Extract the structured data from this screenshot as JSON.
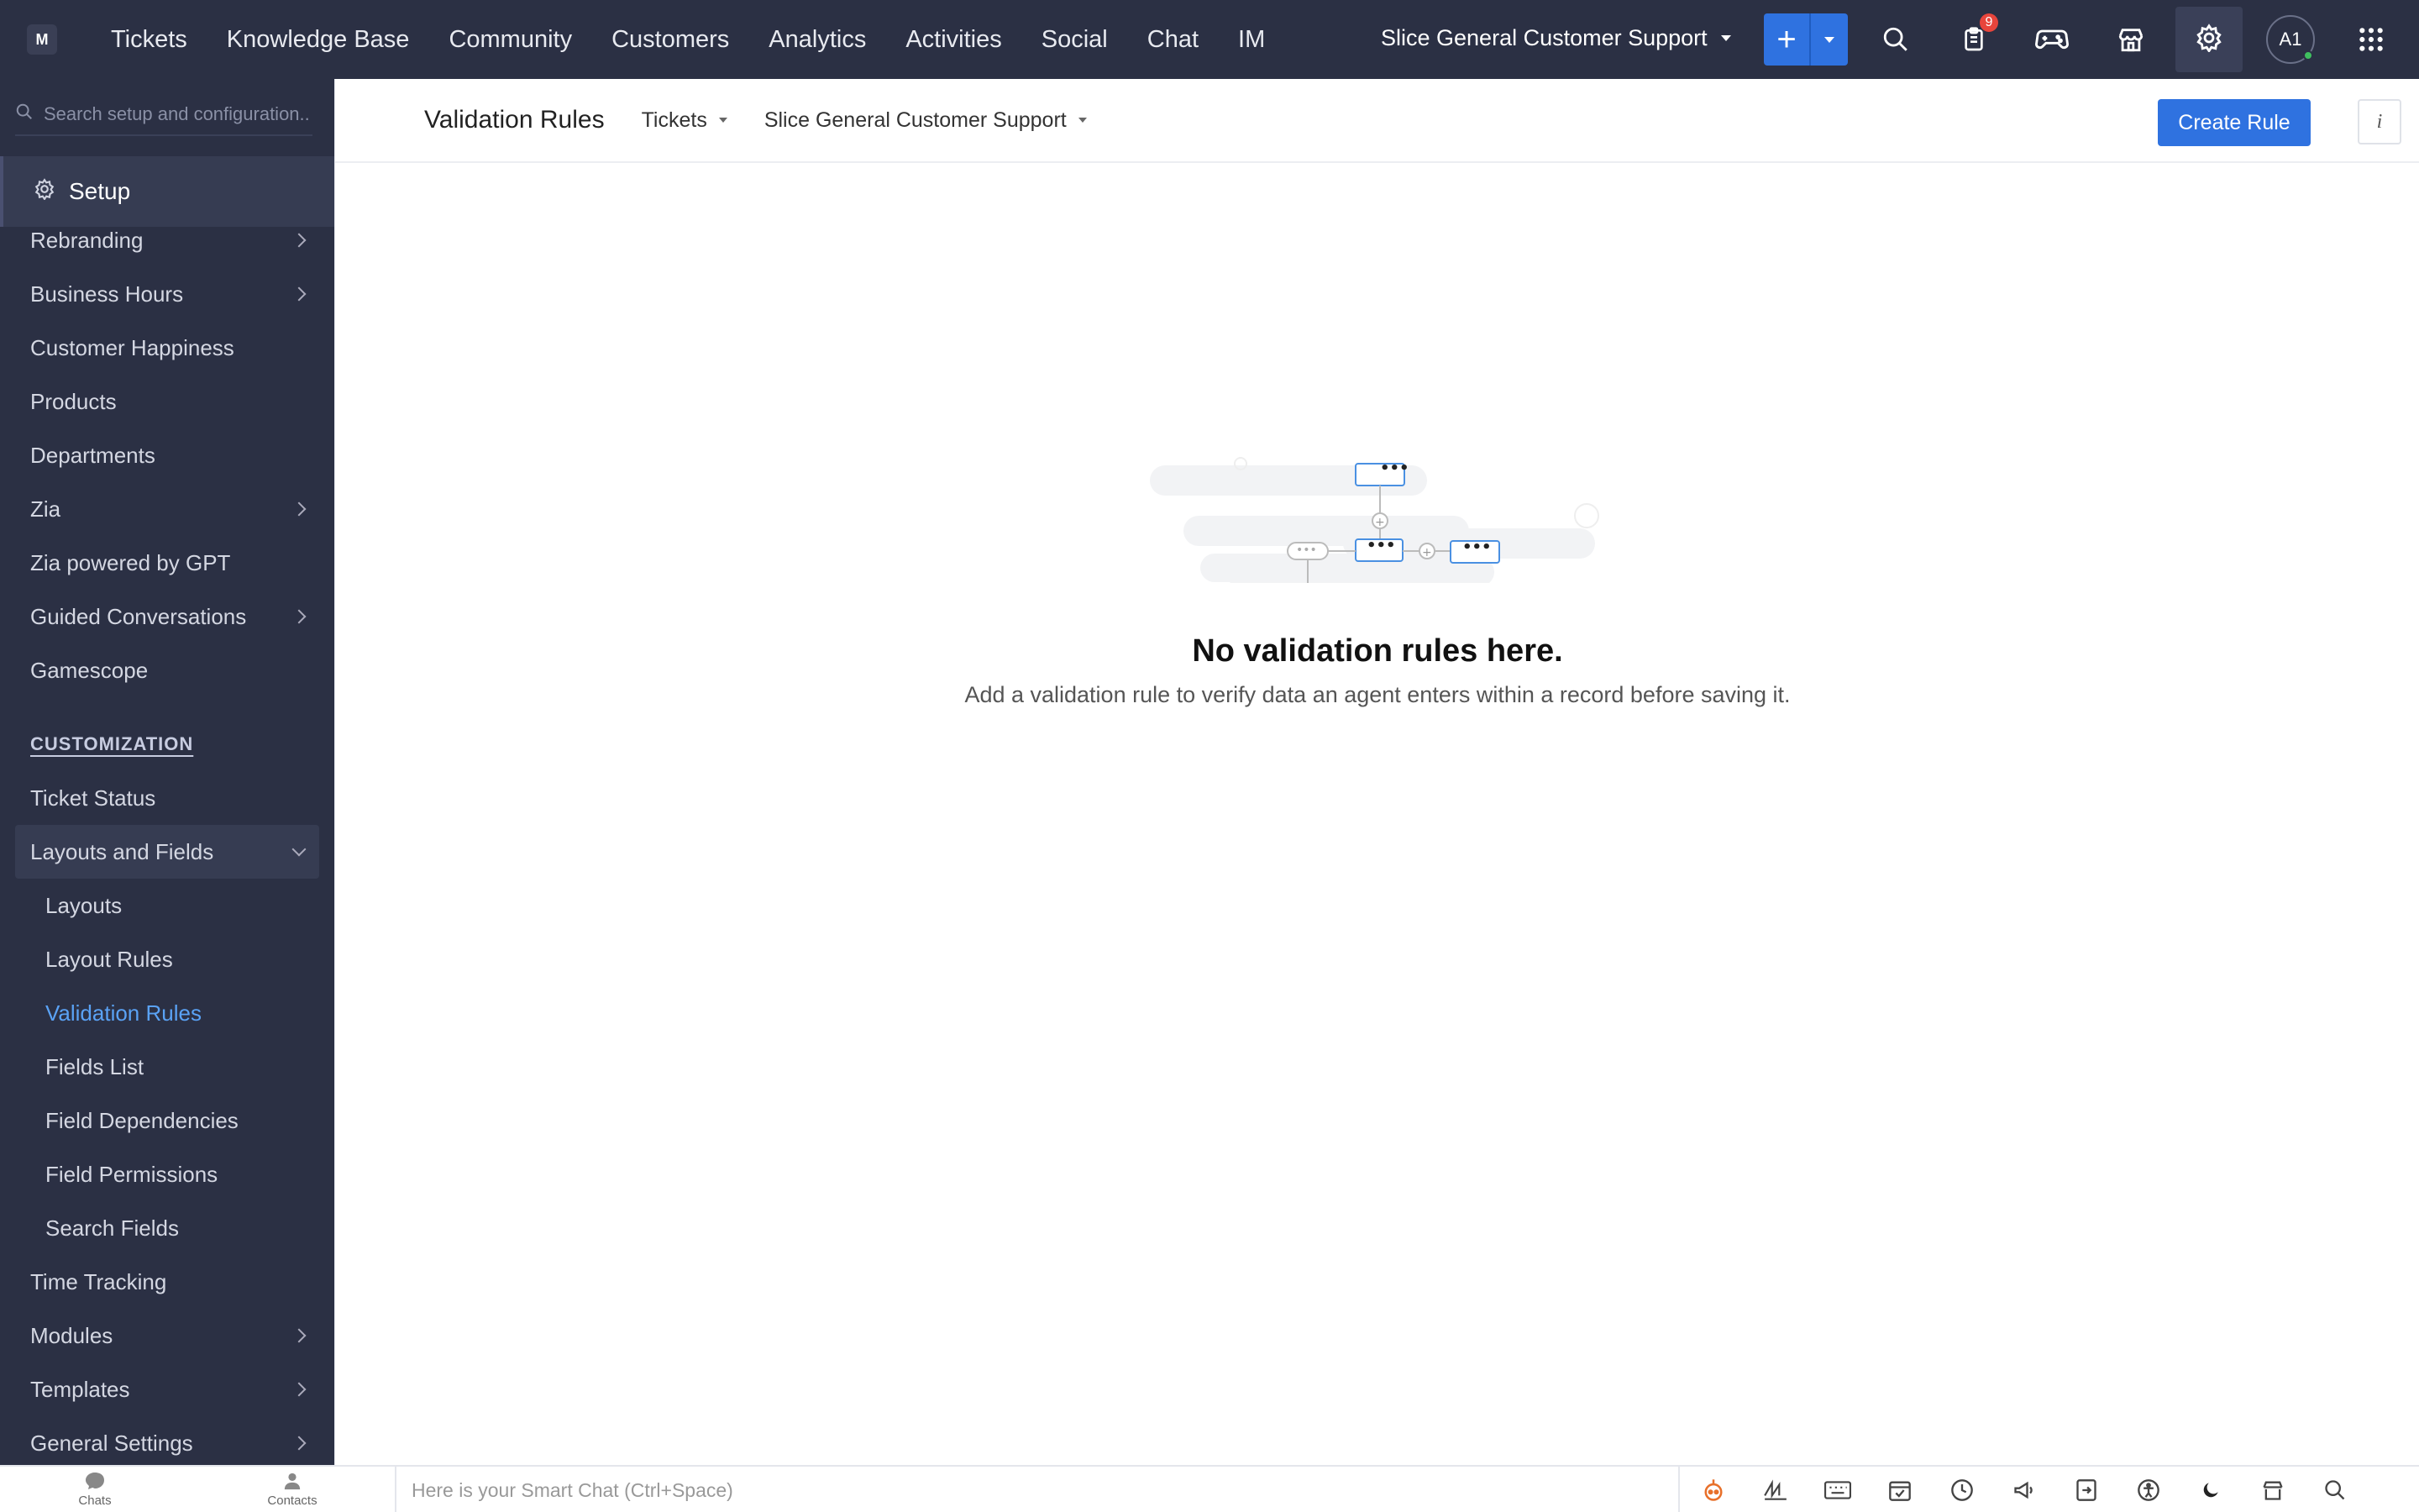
{
  "topnav": {
    "logo": "M",
    "tabs": [
      "Tickets",
      "Knowledge Base",
      "Community",
      "Customers",
      "Analytics",
      "Activities",
      "Social",
      "Chat",
      "IM"
    ],
    "department": "Slice General Customer Support",
    "notif_count": "9",
    "avatar": "A1"
  },
  "sidebar": {
    "search_placeholder": "Search setup and configuration..",
    "setup_label": "Setup",
    "items1": [
      {
        "label": "Rebranding",
        "chevron": true
      },
      {
        "label": "Business Hours",
        "chevron": true
      },
      {
        "label": "Customer Happiness",
        "chevron": false
      },
      {
        "label": "Products",
        "chevron": false
      },
      {
        "label": "Departments",
        "chevron": false
      },
      {
        "label": "Zia",
        "chevron": true
      },
      {
        "label": "Zia powered by GPT",
        "chevron": false
      },
      {
        "label": "Guided Conversations",
        "chevron": true
      },
      {
        "label": "Gamescope",
        "chevron": false
      }
    ],
    "section_customization": "CUSTOMIZATION",
    "ticket_status": "Ticket Status",
    "layouts_and_fields": "Layouts and Fields",
    "subitems": [
      "Layouts",
      "Layout Rules",
      "Validation Rules",
      "Fields List",
      "Field Dependencies",
      "Field Permissions",
      "Search Fields"
    ],
    "active_subitem": "Validation Rules",
    "items2": [
      {
        "label": "Time Tracking",
        "chevron": false
      },
      {
        "label": "Modules",
        "chevron": true
      },
      {
        "label": "Templates",
        "chevron": true
      },
      {
        "label": "General Settings",
        "chevron": true
      }
    ]
  },
  "main": {
    "title": "Validation Rules",
    "module_dropdown": "Tickets",
    "department_dropdown": "Slice General Customer Support",
    "create_button": "Create Rule",
    "info_button": "i",
    "empty_title": "No validation rules here.",
    "empty_desc": "Add a validation rule to verify data an agent enters within a record before saving it."
  },
  "bottombar": {
    "chats": "Chats",
    "contacts": "Contacts",
    "smartchat_placeholder": "Here is your Smart Chat (Ctrl+Space)"
  },
  "colors": {
    "nav_bg": "#2b3044",
    "accent": "#2f72e0",
    "active_link": "#5aa2f5"
  }
}
